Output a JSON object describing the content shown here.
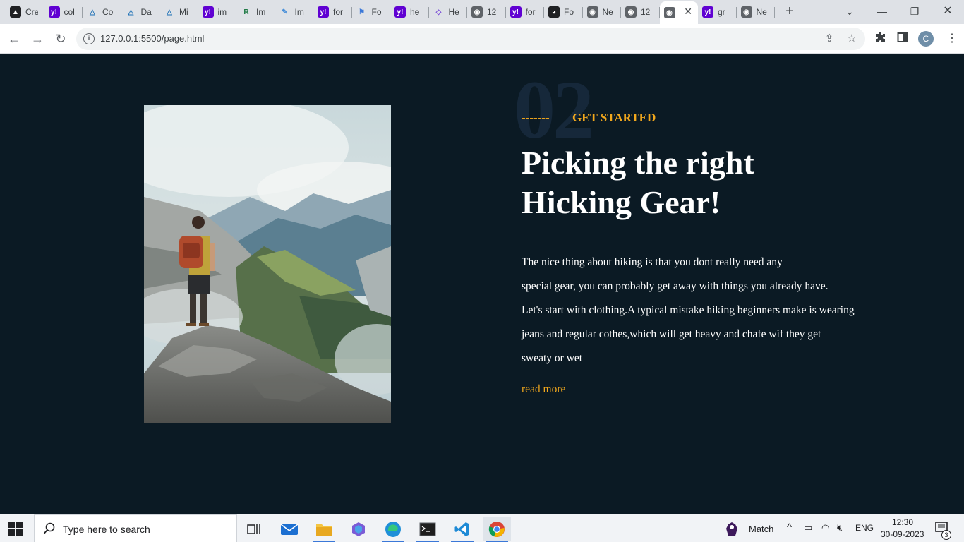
{
  "browser": {
    "tabs": [
      {
        "title": "Cre",
        "icon": "circle-triangle-icon"
      },
      {
        "title": "col",
        "icon": "yahoo-icon"
      },
      {
        "title": "Co",
        "icon": "triangle-logo-icon"
      },
      {
        "title": "Da",
        "icon": "triangle-logo-icon"
      },
      {
        "title": "Mi",
        "icon": "triangle-logo-icon"
      },
      {
        "title": "im",
        "icon": "yahoo-icon"
      },
      {
        "title": "Im",
        "icon": "r-logo-icon"
      },
      {
        "title": "Im",
        "icon": "note-icon"
      },
      {
        "title": "for",
        "icon": "yahoo-icon"
      },
      {
        "title": "Fo",
        "icon": "flag-icon"
      },
      {
        "title": "he",
        "icon": "yahoo-icon"
      },
      {
        "title": "He",
        "icon": "shield-icon"
      },
      {
        "title": "12",
        "icon": "globe-icon"
      },
      {
        "title": "for",
        "icon": "yahoo-icon"
      },
      {
        "title": "Fo",
        "icon": "bot-icon"
      },
      {
        "title": "Ne",
        "icon": "globe-icon"
      },
      {
        "title": "12",
        "icon": "globe-icon"
      },
      {
        "title": "",
        "icon": "globe-icon",
        "active": true
      },
      {
        "title": "gr",
        "icon": "yahoo-icon"
      },
      {
        "title": "Ne",
        "icon": "globe-icon"
      }
    ],
    "url": "127.0.0.1:5500/page.html",
    "profile_initial": "C"
  },
  "page": {
    "number": "02",
    "dash": "-------",
    "kicker": "GET STARTED",
    "headline_lines": [
      "Picking the right",
      "Hicking Gear!"
    ],
    "body_lines": [
      "The nice thing about hiking is that you dont really need any",
      "special gear, you can probably get away with things you already have.",
      "Let's start with clothing.A typical mistake hiking beginners make is wearing",
      "jeans and regular cothes,which will get heavy and chafe wif they get",
      "sweaty or wet"
    ],
    "read_more": "read more",
    "image_alt": "Hiker with red backpack standing on a rock overlooking mountains"
  },
  "taskbar": {
    "search_placeholder": "Type here to search",
    "weather_label": "Match",
    "language": "ENG",
    "time": "12:30",
    "date": "30-09-2023",
    "notification_count": "3"
  },
  "colors": {
    "page_bg": "#0b1a24",
    "accent": "#f2a81d",
    "big_number": "#16283a"
  }
}
